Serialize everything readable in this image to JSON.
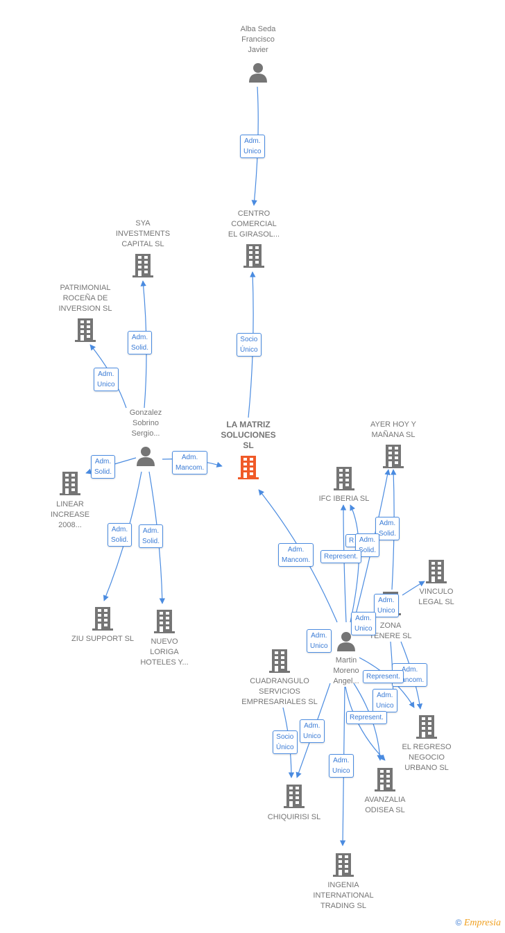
{
  "colors": {
    "edge": "#4a8be0",
    "node": "#757575",
    "focus": "#f05a28"
  },
  "nodes": {
    "alba": {
      "label": [
        "Alba Seda",
        "Francisco",
        "Javier"
      ],
      "type": "person"
    },
    "centro": {
      "label": [
        "CENTRO",
        "COMERCIAL",
        "EL GIRASOL..."
      ],
      "type": "company"
    },
    "sya": {
      "label": [
        "SYA",
        "INVESTMENTS",
        "CAPITAL  SL"
      ],
      "type": "company"
    },
    "patrimonial": {
      "label": [
        "PATRIMONIAL",
        "ROCEÑA DE",
        "INVERSION SL"
      ],
      "type": "company"
    },
    "gonzalez": {
      "label": [
        "Gonzalez",
        "Sobrino",
        "Sergio..."
      ],
      "type": "person"
    },
    "matriz": {
      "label": [
        "LA MATRIZ",
        "SOLUCIONES",
        "SL"
      ],
      "type": "company-focus"
    },
    "linear": {
      "label": [
        "LINEAR",
        "INCREASE",
        "2008..."
      ],
      "type": "company"
    },
    "ziu": {
      "label": [
        "ZIU SUPPORT SL"
      ],
      "type": "company"
    },
    "nuevo": {
      "label": [
        "NUEVO",
        "LORIGA",
        "HOTELES Y..."
      ],
      "type": "company"
    },
    "ayer": {
      "label": [
        "AYER HOY Y",
        "MAÑANA SL"
      ],
      "type": "company"
    },
    "ifc": {
      "label": [
        "IFC IBERIA  SL"
      ],
      "type": "company"
    },
    "vinculo": {
      "label": [
        "VINCULO",
        "LEGAL SL"
      ],
      "type": "company"
    },
    "zona": {
      "label": [
        "ZONA",
        "TENERE SL"
      ],
      "type": "company"
    },
    "martin": {
      "label": [
        "Martin",
        "Moreno",
        "Angel..."
      ],
      "type": "person"
    },
    "cuadrangulo": {
      "label": [
        "CUADRANGULO",
        "SERVICIOS",
        "EMPRESARIALES SL"
      ],
      "type": "company"
    },
    "regreso": {
      "label": [
        "EL REGRESO",
        "NEGOCIO",
        "URBANO SL"
      ],
      "type": "company"
    },
    "avanzalia": {
      "label": [
        "AVANZALIA",
        "ODISEA SL"
      ],
      "type": "company"
    },
    "chiquirisi": {
      "label": [
        "CHIQUIRISI  SL"
      ],
      "type": "company"
    },
    "ingenia": {
      "label": [
        "INGENIA",
        "INTERNATIONAL",
        "TRADING SL"
      ],
      "type": "company"
    }
  },
  "edge_labels": [
    [
      "Adm.",
      "Unico"
    ],
    [
      "Socio",
      "Único"
    ],
    [
      "Adm.",
      "Solid."
    ],
    [
      "Adm.",
      "Unico"
    ],
    [
      "Adm.",
      "Solid."
    ],
    [
      "Adm.",
      "Mancom."
    ],
    [
      "Adm.",
      "Solid."
    ],
    [
      "Adm.",
      "Solid."
    ],
    [
      "Adm.",
      "Mancom."
    ],
    [
      "Adm.",
      "Solid."
    ],
    [
      "R"
    ],
    [
      "Adm.",
      "Solid."
    ],
    [
      "Represent."
    ],
    [
      "Adm.",
      "Unico"
    ],
    [
      "Adm.",
      "Unico"
    ],
    [
      "Adm.",
      "Unico"
    ],
    [
      "Adm.",
      "Mancom."
    ],
    [
      "Represent."
    ],
    [
      "Adm.",
      "Unico"
    ],
    [
      "Represent."
    ],
    [
      "Adm.",
      "Unico"
    ],
    [
      "Socio",
      "Único"
    ],
    [
      "Adm.",
      "Unico"
    ]
  ],
  "footer": {
    "copyright": "©",
    "brand": "Empresia"
  }
}
